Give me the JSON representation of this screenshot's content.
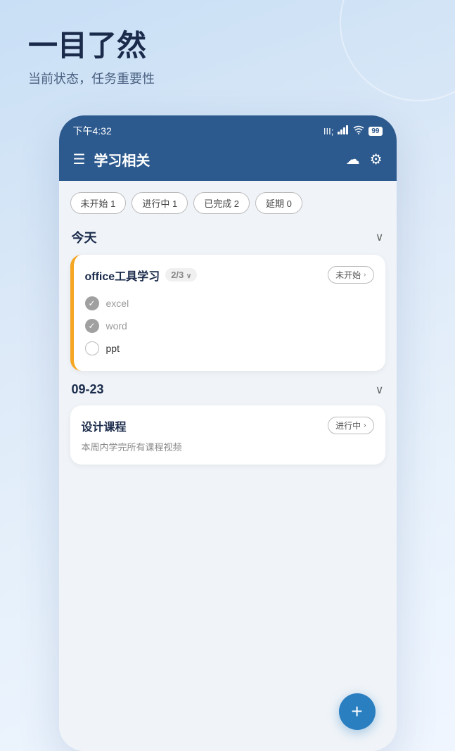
{
  "hero": {
    "title": "一目了然",
    "subtitle": "当前状态，任务重要性"
  },
  "status_bar": {
    "time": "下午4:32",
    "signal": "📶",
    "wifi": "📡",
    "battery": "99"
  },
  "app_header": {
    "title": "学习相关",
    "hamburger_label": "☰",
    "cloud_icon": "☁",
    "settings_icon": "⚙"
  },
  "filter_tabs": [
    {
      "label": "未开始 1"
    },
    {
      "label": "进行中 1"
    },
    {
      "label": "已完成 2"
    },
    {
      "label": "延期 0"
    }
  ],
  "section_today": {
    "title": "今天",
    "chevron": "∨"
  },
  "task_office": {
    "name": "office工具学习",
    "count": "2/3",
    "status": "未开始",
    "subtasks": [
      {
        "name": "excel",
        "done": true
      },
      {
        "name": "word",
        "done": true
      },
      {
        "name": "ppt",
        "done": false
      }
    ]
  },
  "section_date": {
    "title": "09-23",
    "chevron": "∨"
  },
  "task_design": {
    "name": "设计课程",
    "status": "进行中",
    "desc": "本周内学完所有课程视频"
  },
  "fab": {
    "icon": "+"
  }
}
